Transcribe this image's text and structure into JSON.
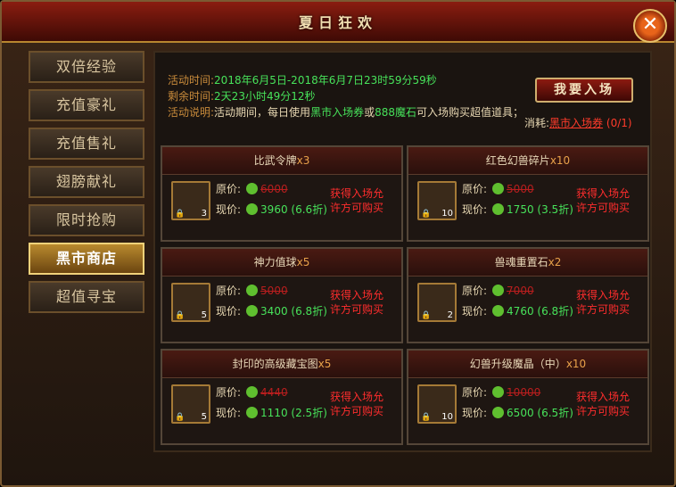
{
  "window": {
    "title": "夏日狂欢",
    "close_symbol": "✕"
  },
  "sidebar": {
    "items": [
      {
        "label": "双倍经验",
        "active": false
      },
      {
        "label": "充值豪礼",
        "active": false
      },
      {
        "label": "充值售礼",
        "active": false
      },
      {
        "label": "翅膀献礼",
        "active": false
      },
      {
        "label": "限时抢购",
        "active": false
      },
      {
        "label": "黑市商店",
        "active": true
      },
      {
        "label": "超值寻宝",
        "active": false
      }
    ]
  },
  "info": {
    "time_label": "活动时间:",
    "time_value": "2018年6月5日-2018年6月7日23时59分59秒",
    "remain_label": "剩余时间:",
    "remain_value": "2天23小时49分12秒",
    "desc_label": "活动说明:",
    "desc_1": "活动期间，每日使用",
    "desc_ticket": "黑市入场券",
    "desc_2": "或",
    "desc_amount": "888魔石",
    "desc_3": "可入场购买超值道具；"
  },
  "enter_button": "我要入场",
  "consume": {
    "label": "消耗:",
    "item": "黑市入场券",
    "count": "(0/1)"
  },
  "price_labels": {
    "orig": "原价:",
    "now": "现价:"
  },
  "hint": "获得入场允许方可购买",
  "cards": [
    {
      "title": "比武令牌",
      "qty_suffix": "x3",
      "badge": "3",
      "orig": "6000",
      "now": "3960",
      "discount": "(6.6折)",
      "icon": "token-icon",
      "col": 0,
      "row": 0
    },
    {
      "title": "红色幻兽碎片",
      "qty_suffix": "x10",
      "badge": "10",
      "orig": "5000",
      "now": "1750",
      "discount": "(3.5折)",
      "icon": "lotus-fragment-icon",
      "col": 1,
      "row": 0
    },
    {
      "title": "神力值球",
      "qty_suffix": "x5",
      "badge": "5",
      "orig": "5000",
      "now": "3400",
      "discount": "(6.8折)",
      "icon": "power-orb-icon",
      "col": 0,
      "row": 1
    },
    {
      "title": "兽魂重置石",
      "qty_suffix": "x2",
      "badge": "2",
      "orig": "7000",
      "now": "4760",
      "discount": "(6.8折)",
      "icon": "reset-stone-icon",
      "col": 1,
      "row": 1
    },
    {
      "title": "封印的高级藏宝图",
      "qty_suffix": "x5",
      "badge": "5",
      "orig": "4440",
      "now": "1110",
      "discount": "(2.5折)",
      "icon": "treasure-map-icon",
      "col": 0,
      "row": 2
    },
    {
      "title": "幻兽升级魔晶（中）",
      "qty_suffix": "x10",
      "badge": "10",
      "orig": "10000",
      "now": "6500",
      "discount": "(6.5折)",
      "icon": "magic-crystal-icon",
      "col": 1,
      "row": 2
    }
  ],
  "colors": {
    "accent": "#8a1d10",
    "green": "#47e25a",
    "red": "#ff3b2b",
    "gold": "#c98b3b"
  }
}
